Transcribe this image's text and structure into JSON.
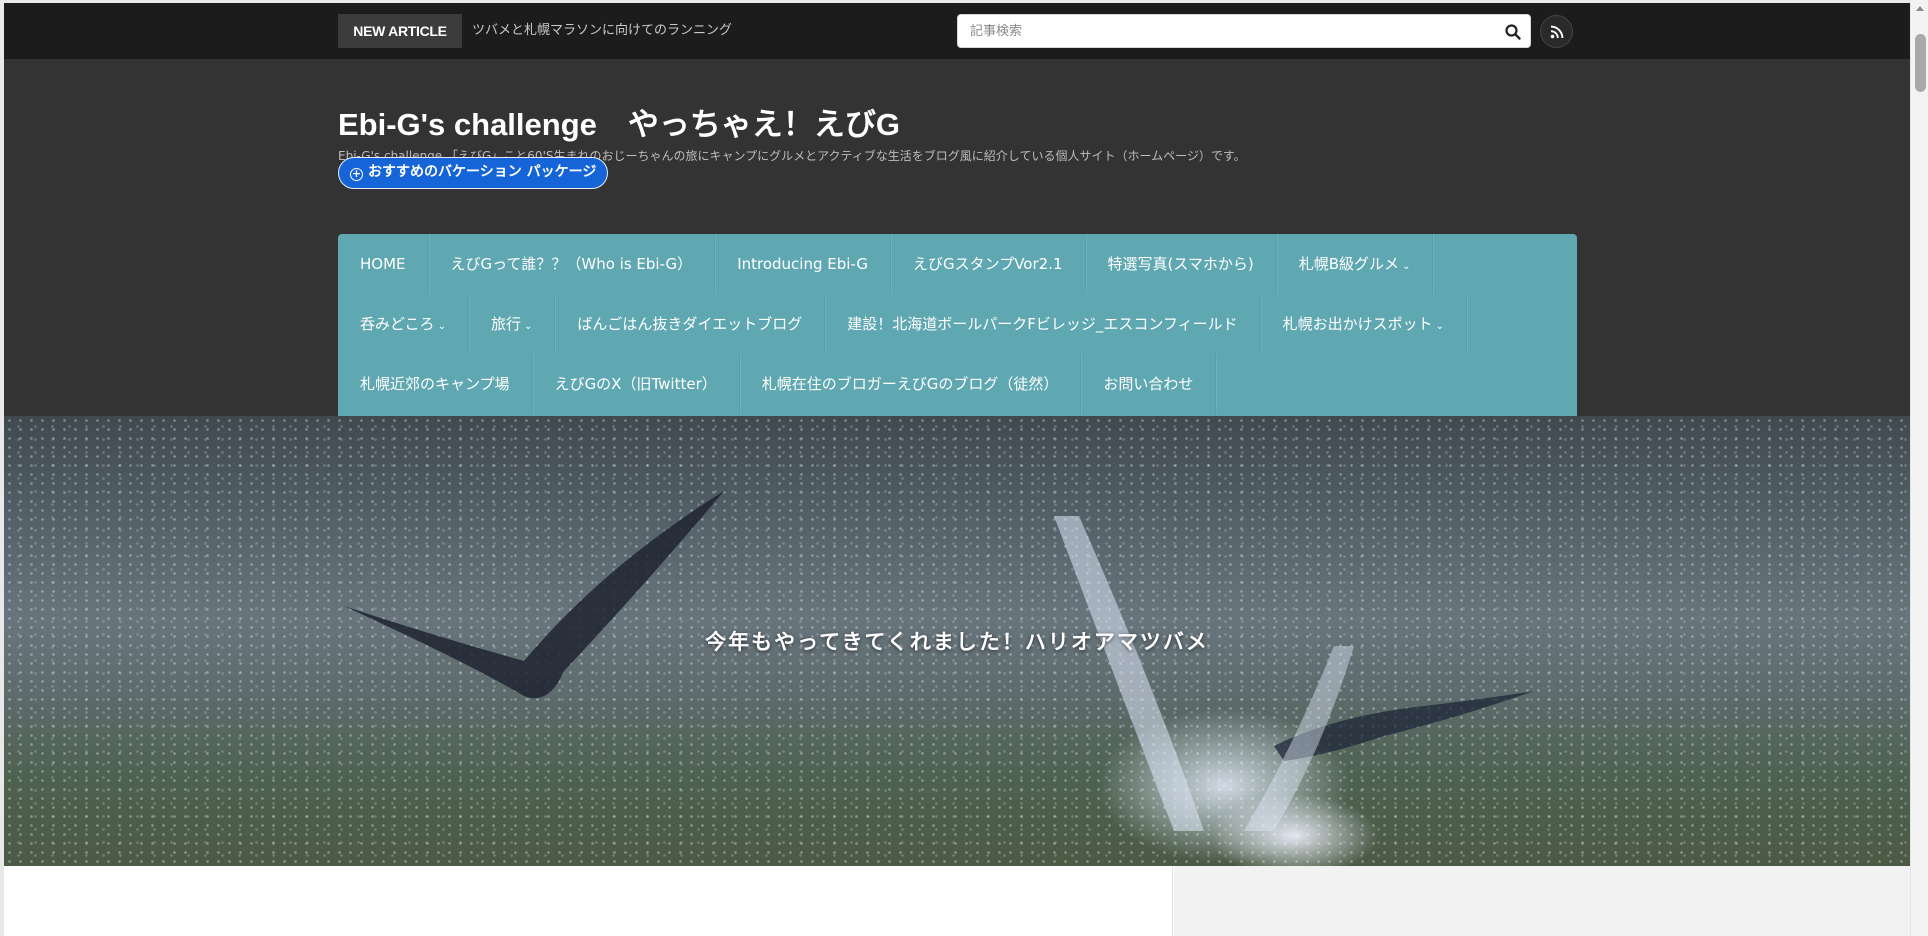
{
  "topbar": {
    "new_article_label": "NEW ARTICLE",
    "ticker_text": "ツバメと札幌マラソンに向けてのランニング",
    "search_placeholder": "記事検索"
  },
  "header": {
    "site_title": "Ebi-G's challenge　やっちゃえ！えびG",
    "site_description": "Ebi-G's challenge 「えびG」こと60'S生まれのおじーちゃんの旅にキャンプにグルメとアクティブな生活をブログ風に紹介している個人サイト（ホームページ）です。",
    "vacation_button": "おすすめのバケーション パッケージ"
  },
  "nav": {
    "row1": [
      {
        "label": "HOME",
        "has_sub": false
      },
      {
        "label": "えびGって誰？？（Who is Ebi-G）",
        "has_sub": false
      },
      {
        "label": "Introducing Ebi-G",
        "has_sub": false
      },
      {
        "label": "えびGスタンプVor2.1",
        "has_sub": false
      },
      {
        "label": "特選写真(スマホから)",
        "has_sub": false
      },
      {
        "label": "札幌B級グルメ",
        "has_sub": true
      }
    ],
    "row2": [
      {
        "label": "呑みどころ",
        "has_sub": true
      },
      {
        "label": "旅行",
        "has_sub": true
      },
      {
        "label": "ばんごはん抜きダイエットブログ",
        "has_sub": false
      },
      {
        "label": "建設！北海道ボールパークFビレッジ_エスコンフィールド",
        "has_sub": false
      },
      {
        "label": "札幌お出かけスポット",
        "has_sub": true
      }
    ],
    "row3": [
      {
        "label": "札幌近郊のキャンプ場",
        "has_sub": false
      },
      {
        "label": "えびGのX（旧Twitter）",
        "has_sub": false
      },
      {
        "label": "札幌在住のブロガーえびGのブログ（徒然）",
        "has_sub": false
      },
      {
        "label": "お問い合わせ",
        "has_sub": false
      }
    ],
    "chevron": "⌄"
  },
  "hero": {
    "title": "今年もやってきてくれました！ハリオアマツバメ"
  },
  "colors": {
    "topbar": "#1c1c1c",
    "header": "#333333",
    "nav": "#5fa8b1",
    "vacation_button": "#1565d8"
  },
  "icons": {
    "search": "search-icon",
    "rss": "rss-icon",
    "plus_circle": "plus-circle-icon"
  }
}
